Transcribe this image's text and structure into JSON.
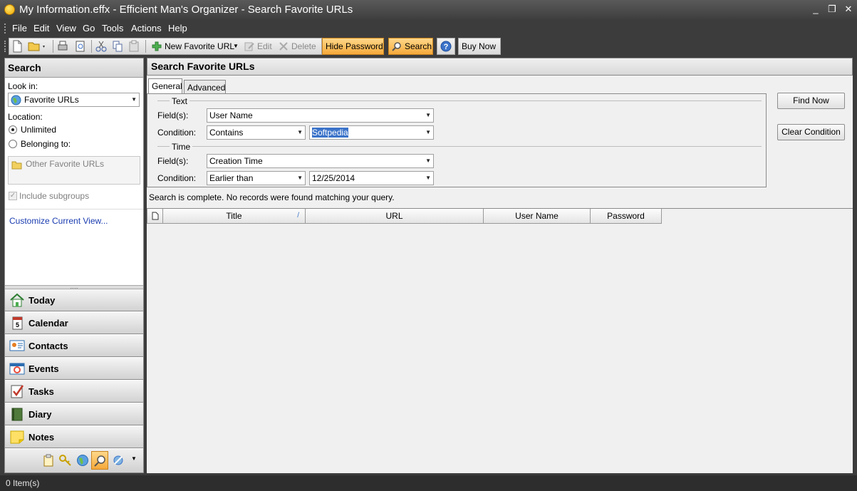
{
  "window": {
    "title": "My Information.effx - Efficient Man's Organizer - Search Favorite URLs",
    "minimize": "_",
    "restore": "❐",
    "close": "✕"
  },
  "menu": [
    "File",
    "Edit",
    "View",
    "Go",
    "Tools",
    "Actions",
    "Help"
  ],
  "toolbar": {
    "new_favorite_url": "New Favorite URL",
    "edit": "Edit",
    "delete": "Delete",
    "hide_password": "Hide Password",
    "search": "Search",
    "buy_now": "Buy Now"
  },
  "search_panel": {
    "title": "Search",
    "look_in_label": "Look in:",
    "look_in_value": "Favorite URLs",
    "location_label": "Location:",
    "unlimited": "Unlimited",
    "belonging_to": "Belonging to:",
    "group_box": "Other Favorite URLs",
    "include_subgroups": "Include subgroups",
    "customize_link": "Customize Current View..."
  },
  "nav": [
    {
      "label": "Today",
      "icon": "home-icon"
    },
    {
      "label": "Calendar",
      "icon": "calendar-icon"
    },
    {
      "label": "Contacts",
      "icon": "contacts-icon"
    },
    {
      "label": "Events",
      "icon": "events-icon"
    },
    {
      "label": "Tasks",
      "icon": "tasks-icon"
    },
    {
      "label": "Diary",
      "icon": "diary-icon"
    },
    {
      "label": "Notes",
      "icon": "notes-icon"
    }
  ],
  "main": {
    "title": "Search Favorite URLs",
    "tabs": [
      "General",
      "Advanced"
    ],
    "text_section": "Text",
    "time_section": "Time",
    "fields_label": "Field(s):",
    "condition_label": "Condition:",
    "text_field": "User Name",
    "text_condition": "Contains",
    "text_value": "Softpedia",
    "time_field": "Creation Time",
    "time_condition": "Earlier than",
    "time_value": "12/25/2014",
    "find_now": "Find Now",
    "clear_condition": "Clear Condition",
    "status": "Search is complete. No records were found matching your query."
  },
  "grid": {
    "columns": [
      "Title",
      "URL",
      "User Name",
      "Password"
    ]
  },
  "statusbar": {
    "items": "0 Item(s)"
  },
  "colors": {
    "highlight_button": "#f5a93a",
    "selection": "#3b73c9",
    "link": "#1a3cb0"
  }
}
